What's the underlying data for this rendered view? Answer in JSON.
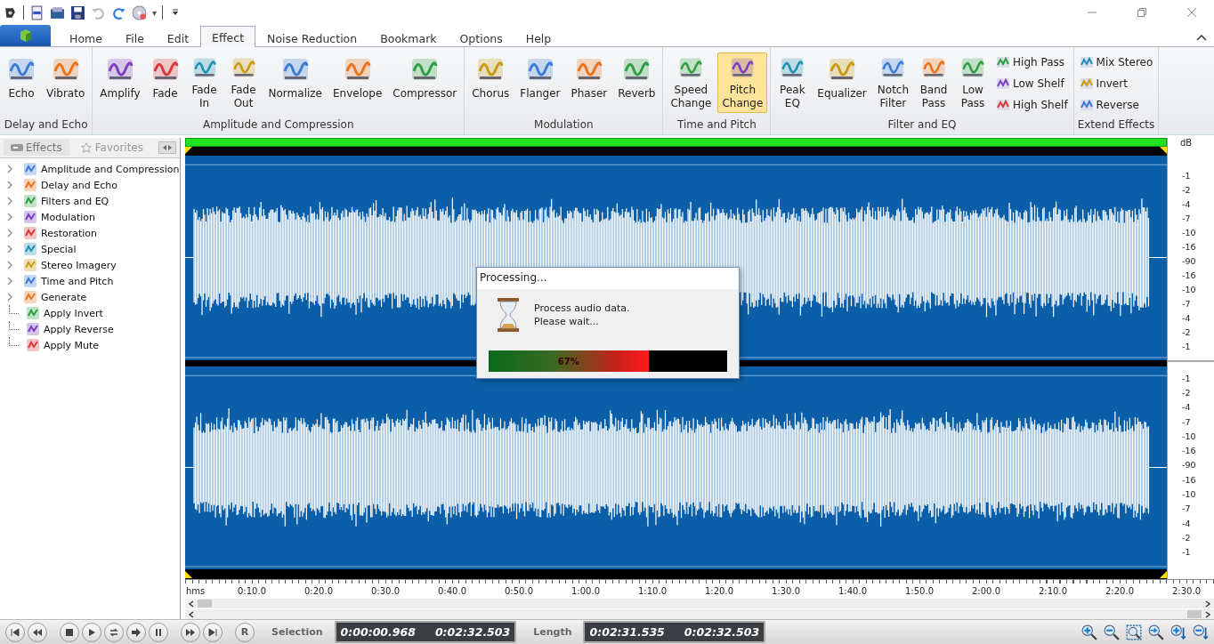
{
  "quick_access": {
    "dropdown": "▾"
  },
  "tabs": [
    {
      "label": "Home",
      "selected": false
    },
    {
      "label": "File",
      "selected": false
    },
    {
      "label": "Edit",
      "selected": false
    },
    {
      "label": "Effect",
      "selected": true
    },
    {
      "label": "Noise Reduction",
      "selected": false
    },
    {
      "label": "Bookmark",
      "selected": false
    },
    {
      "label": "Options",
      "selected": false
    },
    {
      "label": "Help",
      "selected": false
    }
  ],
  "ribbon": [
    {
      "label": "Delay and Echo",
      "items": [
        {
          "label": "Echo",
          "kind": "large",
          "selected": false
        },
        {
          "label": "Vibrato",
          "kind": "large",
          "selected": false
        }
      ]
    },
    {
      "label": "Amplitude and Compression",
      "items": [
        {
          "label": "Amplify",
          "kind": "large",
          "selected": false
        },
        {
          "label": "Fade",
          "kind": "large",
          "selected": false
        },
        {
          "label": "Fade\nIn",
          "kind": "large",
          "selected": false
        },
        {
          "label": "Fade\nOut",
          "kind": "large",
          "selected": false
        },
        {
          "label": "Normalize",
          "kind": "large",
          "selected": false
        },
        {
          "label": "Envelope",
          "kind": "large",
          "selected": false
        },
        {
          "label": "Compressor",
          "kind": "large",
          "selected": false
        }
      ]
    },
    {
      "label": "Modulation",
      "items": [
        {
          "label": "Chorus",
          "kind": "large",
          "selected": false
        },
        {
          "label": "Flanger",
          "kind": "large",
          "selected": false
        },
        {
          "label": "Phaser",
          "kind": "large",
          "selected": false
        },
        {
          "label": "Reverb",
          "kind": "large",
          "selected": false
        }
      ]
    },
    {
      "label": "Time and Pitch",
      "items": [
        {
          "label": "Speed\nChange",
          "kind": "large",
          "selected": false
        },
        {
          "label": "Pitch\nChange",
          "kind": "large",
          "selected": true
        }
      ]
    },
    {
      "label": "Filter and EQ",
      "items": [
        {
          "label": "Peak\nEQ",
          "kind": "large",
          "selected": false
        },
        {
          "label": "Equalizer",
          "kind": "large",
          "selected": false
        },
        {
          "label": "Notch\nFilter",
          "kind": "large",
          "selected": false
        },
        {
          "label": "Band\nPass",
          "kind": "large",
          "selected": false
        },
        {
          "label": "Low\nPass",
          "kind": "large",
          "selected": false
        },
        {
          "label": "High Pass",
          "kind": "small",
          "selected": false
        },
        {
          "label": "Low Shelf",
          "kind": "small",
          "selected": false
        },
        {
          "label": "High Shelf",
          "kind": "small",
          "selected": false
        }
      ]
    },
    {
      "label": "Extend Effects",
      "items": [
        {
          "label": "Mix Stereo",
          "kind": "small",
          "selected": false
        },
        {
          "label": "Invert",
          "kind": "small",
          "selected": false
        },
        {
          "label": "Reverse",
          "kind": "small",
          "selected": false
        }
      ]
    }
  ],
  "sidebar": {
    "tabs": [
      {
        "label": "Effects",
        "selected": true
      },
      {
        "label": "Favorites",
        "selected": false
      }
    ],
    "items": [
      {
        "label": "Amplitude and Compression",
        "kind": "group",
        "expanded": false
      },
      {
        "label": "Delay and Echo",
        "kind": "group",
        "expanded": false
      },
      {
        "label": "Filters and EQ",
        "kind": "group",
        "expanded": false
      },
      {
        "label": "Modulation",
        "kind": "group",
        "expanded": false
      },
      {
        "label": "Restoration",
        "kind": "group",
        "expanded": false
      },
      {
        "label": "Special",
        "kind": "group",
        "expanded": false
      },
      {
        "label": "Stereo Imagery",
        "kind": "group",
        "expanded": false
      },
      {
        "label": "Time and Pitch",
        "kind": "group",
        "expanded": false
      },
      {
        "label": "Generate",
        "kind": "group",
        "expanded": false
      },
      {
        "label": "Apply Invert",
        "kind": "action"
      },
      {
        "label": "Apply Reverse",
        "kind": "action"
      },
      {
        "label": "Apply Mute",
        "kind": "action"
      }
    ]
  },
  "db_scale": {
    "unit": "dB",
    "channels": [
      [
        "-1",
        "-2",
        "-4",
        "-7",
        "-10",
        "-16",
        "-90",
        "-16",
        "-10",
        "-7",
        "-4",
        "-2",
        "-1"
      ],
      [
        "-1",
        "-2",
        "-4",
        "-7",
        "-10",
        "-16",
        "-90",
        "-16",
        "-10",
        "-7",
        "-4",
        "-2",
        "-1"
      ]
    ]
  },
  "time_ruler": [
    "hms",
    "0:10.0",
    "0:20.0",
    "0:30.0",
    "0:40.0",
    "0:50.0",
    "1:00.0",
    "1:10.0",
    "1:20.0",
    "1:30.0",
    "1:40.0",
    "1:50.0",
    "2:00.0",
    "2:10.0",
    "2:20.0",
    "2:30.0"
  ],
  "dialog": {
    "title": "Processing...",
    "message": "Process audio data.\nPlease wait...",
    "level": 0.67,
    "percent": "67%"
  },
  "transport": {
    "record": "R",
    "selection_label": "Selection",
    "selection_start": "0:00:00.968",
    "selection_end": "0:02:32.503",
    "length_label": "Length",
    "length": "0:02:31.535",
    "total": "0:02:32.503"
  }
}
